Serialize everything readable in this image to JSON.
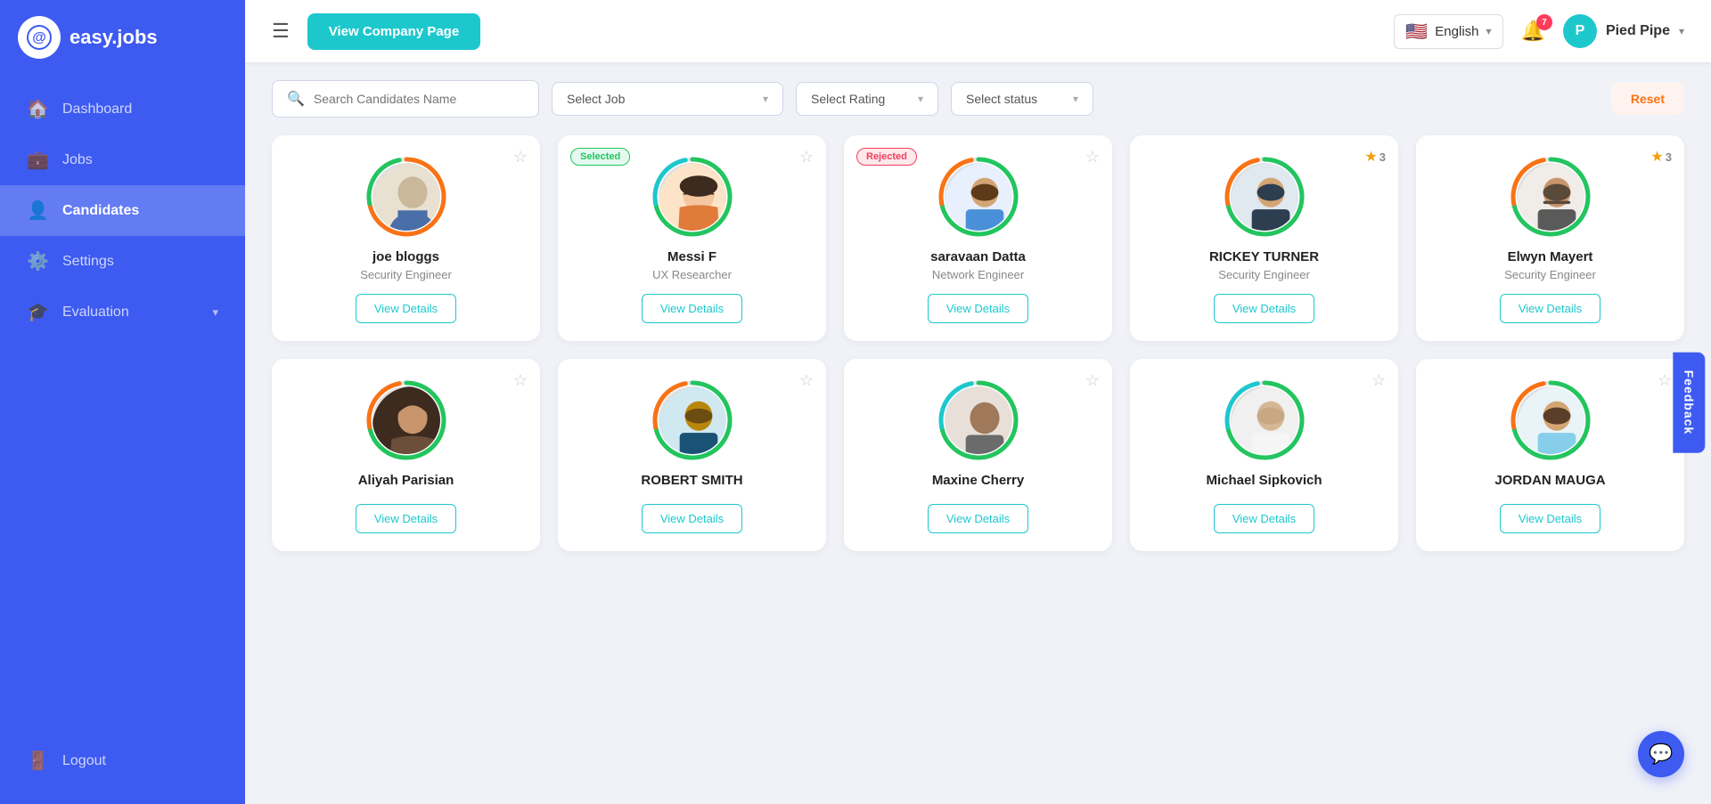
{
  "sidebar": {
    "logo_text": "easy.jobs",
    "items": [
      {
        "label": "Dashboard",
        "icon": "🏠",
        "active": false
      },
      {
        "label": "Jobs",
        "icon": "💼",
        "active": false
      },
      {
        "label": "Candidates",
        "icon": "👤",
        "active": true
      },
      {
        "label": "Settings",
        "icon": "⚙️",
        "active": false
      },
      {
        "label": "Evaluation",
        "icon": "🎓",
        "active": false
      }
    ],
    "logout_label": "Logout",
    "logout_icon": "🚪"
  },
  "header": {
    "view_company_label": "View Company Page",
    "language": "English",
    "bell_count": "7",
    "user_name": "Pied Pipe"
  },
  "filters": {
    "search_placeholder": "Search Candidates Name",
    "select_job_label": "Select Job",
    "select_rating_label": "Select Rating",
    "select_status_label": "Select status",
    "reset_label": "Reset"
  },
  "candidates_row1": [
    {
      "name": "joe bloggs",
      "role": "Security Engineer",
      "badge": null,
      "star_count": null,
      "ring_colors": [
        "#f97316",
        "#22c55e"
      ],
      "avatar_type": "placeholder",
      "avatar_emoji": "👤"
    },
    {
      "name": "Messi F",
      "role": "UX Researcher",
      "badge": "Selected",
      "badge_type": "selected",
      "star_count": null,
      "ring_colors": [
        "#22c55e",
        "#1dc8cd"
      ],
      "avatar_type": "placeholder",
      "avatar_emoji": "👩"
    },
    {
      "name": "saravaan Datta",
      "role": "Network Engineer",
      "badge": "Rejected",
      "badge_type": "rejected",
      "star_count": null,
      "ring_colors": [
        "#22c55e",
        "#f97316"
      ],
      "avatar_type": "placeholder",
      "avatar_emoji": "👨"
    },
    {
      "name": "RICKEY TURNER",
      "role": "Security Engineer",
      "badge": null,
      "star_count": "3",
      "ring_colors": [
        "#22c55e",
        "#f97316"
      ],
      "avatar_type": "placeholder",
      "avatar_emoji": "👨"
    },
    {
      "name": "Elwyn Mayert",
      "role": "Security Engineer",
      "badge": null,
      "star_count": "3",
      "ring_colors": [
        "#22c55e",
        "#f97316"
      ],
      "avatar_type": "placeholder",
      "avatar_emoji": "👨"
    }
  ],
  "candidates_row2": [
    {
      "name": "Aliyah Parisian",
      "role": "",
      "badge": null,
      "star_count": null,
      "ring_colors": [
        "#22c55e",
        "#f97316"
      ],
      "avatar_type": "placeholder",
      "avatar_emoji": "👩"
    },
    {
      "name": "ROBERT SMITH",
      "role": "",
      "badge": null,
      "star_count": null,
      "ring_colors": [
        "#22c55e",
        "#f97316"
      ],
      "avatar_type": "placeholder",
      "avatar_emoji": "👨"
    },
    {
      "name": "Maxine Cherry",
      "role": "",
      "badge": null,
      "star_count": null,
      "ring_colors": [
        "#22c55e",
        "#1dc8cd"
      ],
      "avatar_type": "placeholder",
      "avatar_emoji": "👨"
    },
    {
      "name": "Michael Sipkovich",
      "role": "",
      "badge": null,
      "star_count": null,
      "ring_colors": [
        "#22c55e",
        "#1dc8cd"
      ],
      "avatar_type": "placeholder",
      "avatar_emoji": "👨"
    },
    {
      "name": "JORDAN MAUGA",
      "role": "",
      "badge": null,
      "star_count": null,
      "ring_colors": [
        "#22c55e",
        "#f97316"
      ],
      "avatar_type": "placeholder",
      "avatar_emoji": "👨"
    }
  ],
  "feedback_label": "Feedback",
  "view_details_label": "View Details"
}
